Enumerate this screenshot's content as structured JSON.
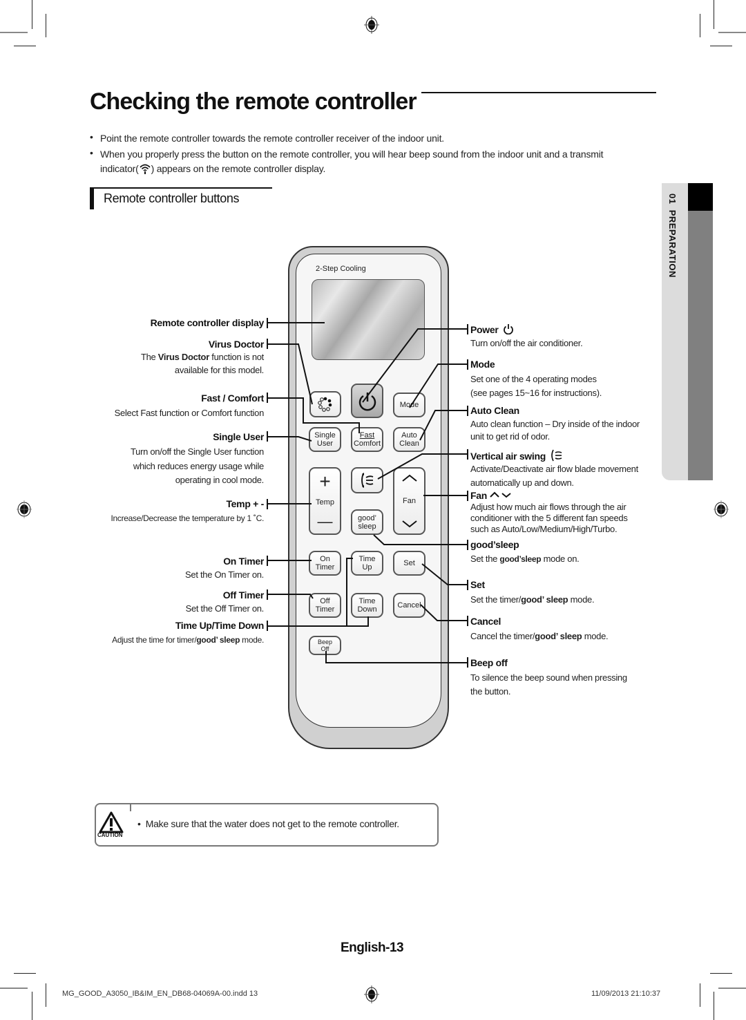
{
  "title": "Checking the remote controller",
  "bullets": [
    "Point the remote controller towards the remote controller receiver of the indoor unit.",
    "When you properly press the button on the remote controller, you will hear beep sound from the indoor unit and a transmit",
    "indicator(",
    ") appears on the remote controller display."
  ],
  "bullet_mark": "•",
  "subheading": "Remote controller buttons",
  "side_tab": {
    "number": "01",
    "label": "PREPARATION"
  },
  "remote": {
    "brand_label": "2-Step Cooling",
    "buttons": {
      "mode": "Mode",
      "single_user": [
        "Single",
        "User"
      ],
      "fast_comfort": [
        "Fast",
        "Comfort"
      ],
      "auto_clean": [
        "Auto",
        "Clean"
      ],
      "temp": "Temp",
      "temp_plus": "+",
      "temp_minus": "—",
      "fan": "Fan",
      "good_sleep": [
        "good’",
        "sleep"
      ],
      "on_timer": [
        "On",
        "Timer"
      ],
      "time_up": [
        "Time",
        "Up"
      ],
      "set": "Set",
      "off_timer": [
        "Off",
        "Timer"
      ],
      "time_down": [
        "Time",
        "Down"
      ],
      "cancel": "Cancel",
      "beep_off": [
        "Beep",
        "Off"
      ]
    }
  },
  "left_labels": [
    {
      "name": "Remote controller display"
    },
    {
      "name": "Virus Doctor",
      "desc_pre": "The ",
      "desc_bold": "Virus Doctor",
      "desc_post": " function is not",
      "desc2": "available for this model."
    },
    {
      "name": "Fast / Comfort",
      "desc": "Select Fast function or Comfort function"
    },
    {
      "name": "Single User",
      "desc": "Turn on/off the Single User function",
      "desc2": "which reduces energy usage while",
      "desc3": "operating in cool mode."
    },
    {
      "name": "Temp + -",
      "desc": "Increase/Decrease the temperature by 1 ˚C."
    },
    {
      "name": "On Timer",
      "desc": "Set the On Timer on."
    },
    {
      "name": "Off Timer",
      "desc": "Set the Off Timer on."
    },
    {
      "name": "Time Up/Time Down",
      "desc_pre": "Adjust the time for timer/",
      "desc_bold": "good’ sleep",
      "desc_post": " mode."
    }
  ],
  "right_labels": [
    {
      "name": "Power",
      "desc": "Turn on/off the air conditioner."
    },
    {
      "name": "Mode",
      "desc": "Set one of the 4 operating modes",
      "desc2": "(see pages 15~16 for instructions)."
    },
    {
      "name": "Auto Clean",
      "desc": "Auto clean function – Dry inside of the indoor",
      "desc2": "unit to get rid of odor."
    },
    {
      "name": "Vertical air swing",
      "desc": "Activate/Deactivate air flow blade movement",
      "desc2": "automatically up and down."
    },
    {
      "name": "Fan",
      "desc": "Adjust how much air flows through the air",
      "desc2": "conditioner with the 5 different fan speeds",
      "desc3": "such as Auto/Low/Medium/High/Turbo."
    },
    {
      "name": "good’sleep",
      "desc_pre": "Set the ",
      "desc_bold": "good’sleep",
      "desc_post": " mode on."
    },
    {
      "name": "Set",
      "desc_pre": "Set the timer/",
      "desc_bold": "good’ sleep",
      "desc_post": " mode."
    },
    {
      "name": "Cancel",
      "desc_pre": "Cancel the timer/",
      "desc_bold": "good’ sleep",
      "desc_post": " mode."
    },
    {
      "name": "Beep off",
      "desc": "To silence the beep sound when pressing",
      "desc2": "the button."
    }
  ],
  "caution": {
    "label": "CAUTION",
    "text": "Make sure that the water does not get to the remote controller."
  },
  "page_number": "English-13",
  "footer": {
    "file": "MG_GOOD_A3050_IB&IM_EN_DB68-04069A-00.indd   13",
    "timestamp": "11/09/2013   21:10:37"
  }
}
